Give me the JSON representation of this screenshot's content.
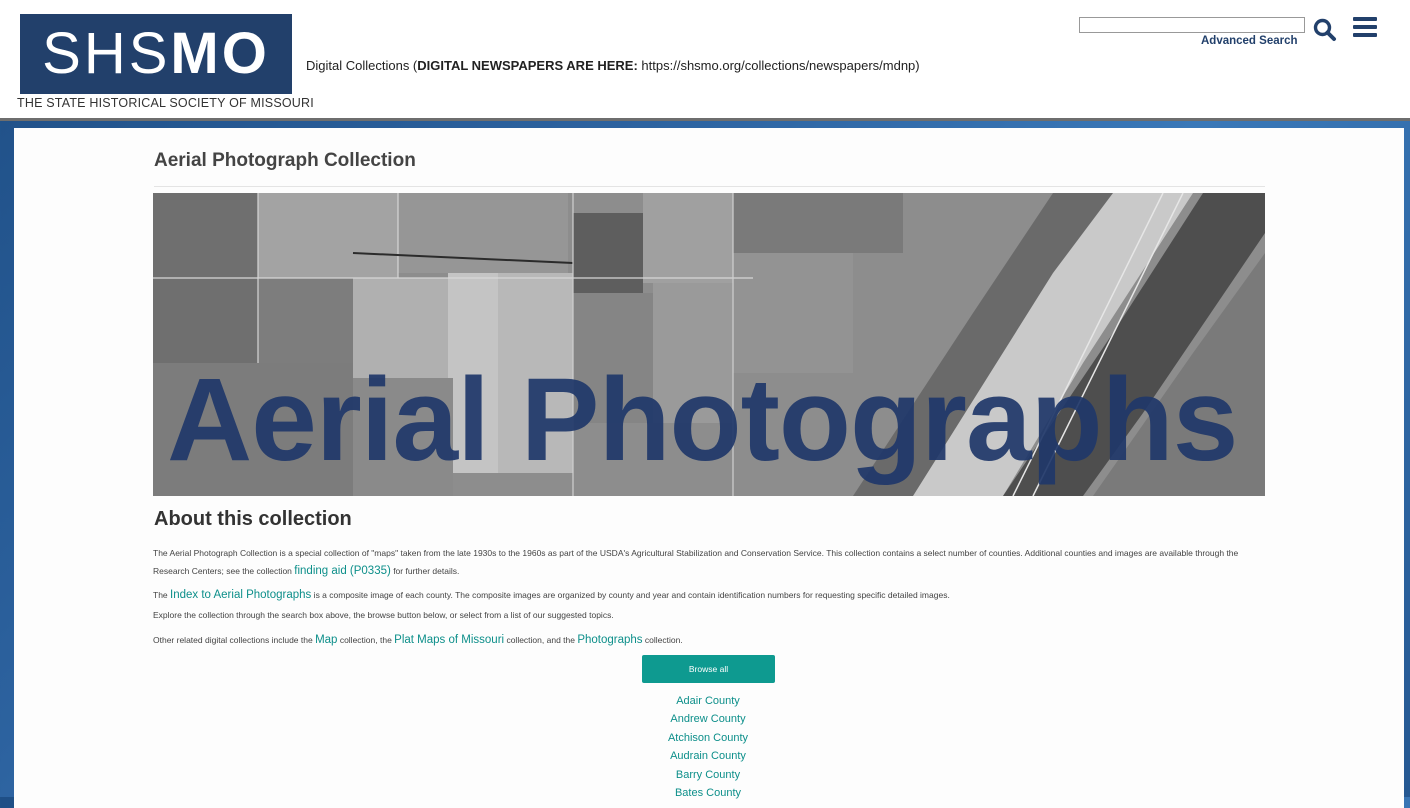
{
  "header": {
    "logo_word_light": "SHS",
    "logo_word_bold": "MO",
    "logo_tagline": "THE STATE HISTORICAL SOCIETY OF MISSOURI",
    "notice_prefix": "Digital Collections (",
    "notice_strong": "DIGITAL NEWSPAPERS ARE HERE:",
    "notice_suffix": " https://shsmo.org/collections/newspapers/mdnp)",
    "search_value": "",
    "advanced_search_label": "Advanced Search",
    "icons": {
      "search": "search-icon",
      "menu": "hamburger-menu-icon"
    },
    "brand_color": "#22406b"
  },
  "main": {
    "title": "Aerial Photograph Collection",
    "hero_text": "Aerial Photographs",
    "about_title": "About this collection",
    "p1": {
      "before": "The Aerial Photograph Collection is a special collection of \"maps\" taken from the late 1930s to the 1960s as part of the USDA's Agricultural Stabilization and Conservation Service. This collection contains a select number of counties. Additional counties and images are available through the Research Centers; see the collection ",
      "link": "finding aid (P0335)",
      "after": " for further details."
    },
    "p2": {
      "before": "The ",
      "link": "Index to Aerial Photographs",
      "after": " is a composite image of each county. The composite images are organized by county and year and contain identification numbers for requesting specific detailed images."
    },
    "p3": "Explore the collection through the search box above, the browse button below, or select from a list of our suggested topics.",
    "p4": {
      "t1": "Other related digital collections include the ",
      "l1": "Map",
      "t2": " collection, the ",
      "l2": "Plat Maps of Missouri",
      "t3": " collection, and the ",
      "l3": "Photographs",
      "t4": " collection."
    },
    "browse_label": "Browse all",
    "link_color": "#0d8f8a",
    "button_color": "#0e9a90",
    "topics": [
      "Adair County",
      "Andrew County",
      "Atchison County",
      "Audrain County",
      "Barry County",
      "Bates County"
    ]
  }
}
